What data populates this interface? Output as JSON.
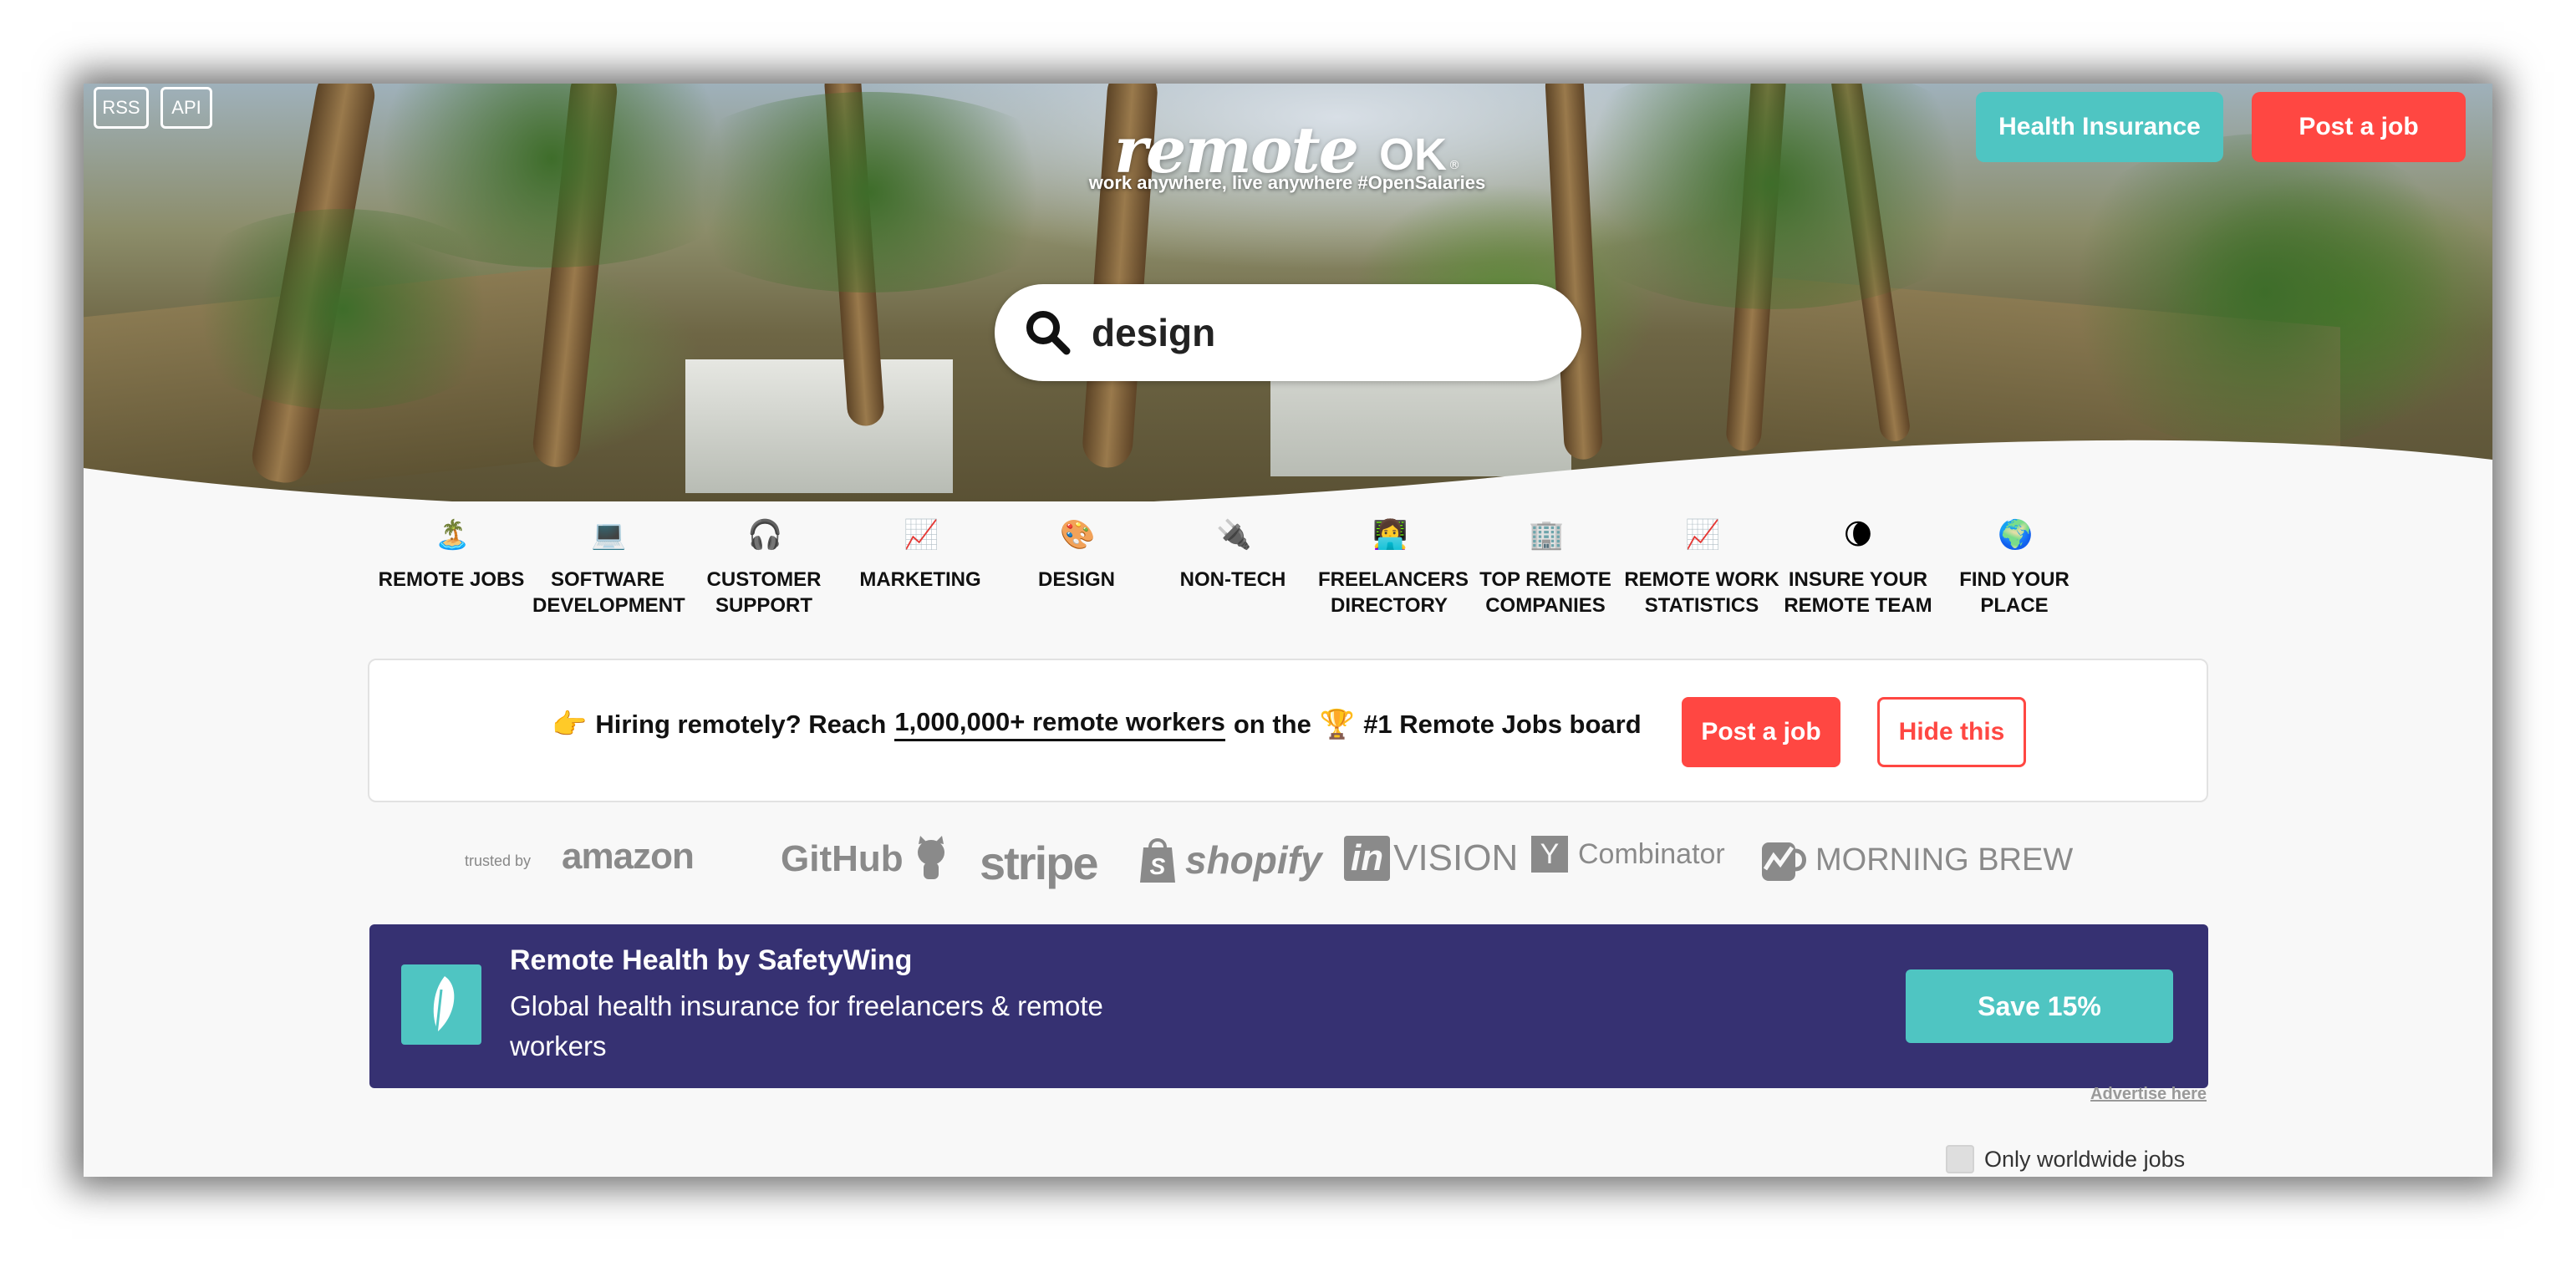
{
  "header": {
    "rss_label": "RSS",
    "api_label": "API",
    "logo_remote": "remote",
    "logo_ok": "OK",
    "logo_registered": "®",
    "tagline": "work anywhere, live anywhere #OpenSalaries",
    "health_insurance_label": "Health Insurance",
    "post_job_label": "Post a job"
  },
  "search": {
    "value": "design",
    "icon": "search-icon"
  },
  "categories": [
    {
      "icon": "🏝️",
      "label": "REMOTE JOBS"
    },
    {
      "icon": "💻",
      "label": "SOFTWARE DEVELOPMENT"
    },
    {
      "icon": "🎧",
      "label": "CUSTOMER SUPPORT"
    },
    {
      "icon": "📈",
      "label": "MARKETING"
    },
    {
      "icon": "🎨",
      "label": "DESIGN"
    },
    {
      "icon": "🔌",
      "label": "NON-TECH"
    },
    {
      "icon": "👩‍💻",
      "label": "FREELANCERS DIRECTORY"
    },
    {
      "icon": "🏢",
      "label": "TOP REMOTE COMPANIES"
    },
    {
      "icon": "📈",
      "label": "REMOTE WORK STATISTICS"
    },
    {
      "icon": "🌘",
      "label": "INSURE YOUR REMOTE TEAM"
    },
    {
      "icon": "🌍",
      "label": "FIND YOUR PLACE"
    }
  ],
  "hiring_banner": {
    "pointer_emoji": "👉",
    "text_before": "Hiring remotely? Reach",
    "link_text": "1,000,000+ remote workers",
    "text_middle": "on the",
    "trophy_emoji": "🏆",
    "text_after": "#1 Remote Jobs board",
    "post_label": "Post a job",
    "hide_label": "Hide this"
  },
  "trusted": {
    "label": "trusted by",
    "brands": [
      "amazon",
      "GitHub",
      "stripe",
      "shopify",
      "in",
      "VISION",
      "Y",
      "Combinator",
      "MORNING BREW"
    ]
  },
  "sponsor": {
    "title": "Remote Health by SafetyWing",
    "description": "Global health insurance for freelancers & remote workers",
    "button_label": "Save 15%",
    "advertise_label": "Advertise here",
    "colors": {
      "background": "#363172",
      "accent": "#4fc5c2"
    }
  },
  "filters": {
    "worldwide_label": "Only worldwide jobs",
    "worldwide_checked": false
  },
  "colors": {
    "brand_red": "#ff4742",
    "teal": "#4fc5c2"
  }
}
